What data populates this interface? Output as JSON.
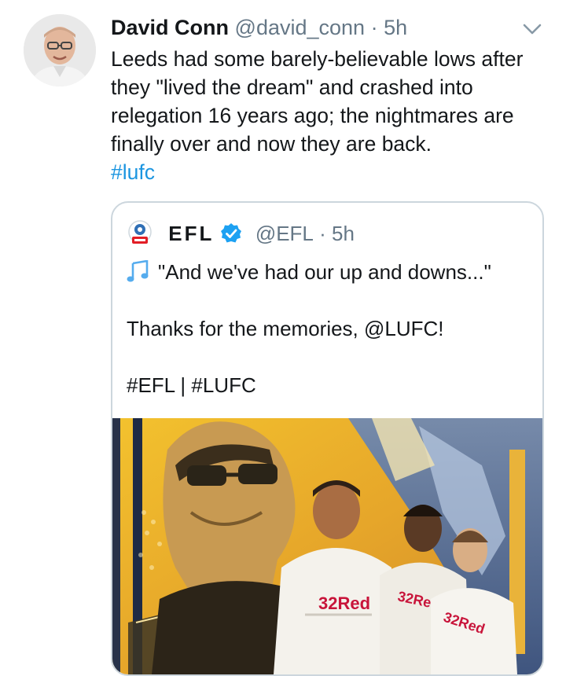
{
  "tweet": {
    "author_name": "David Conn",
    "author_handle": "@david_conn",
    "separator": "·",
    "time": "5h",
    "text": "Leeds had some barely-believable lows after they \"lived the dream\" and crashed into relegation 16 years ago; the nightmares are finally over and now they are back.",
    "hashtag": "#lufc",
    "avatar_icon": "avatar-photo",
    "menu_icon": "chevron-down-icon"
  },
  "quoted_tweet": {
    "author_name": "EFL",
    "verified": true,
    "author_handle": "@EFL",
    "separator": "·",
    "time": "5h",
    "line1": "\"And we've had our up and downs...\"",
    "line2": "Thanks for the memories, @LUFC!",
    "line3": "#EFL | #LUFC",
    "media": {
      "jersey_text_1": "32Red",
      "jersey_text_2": "32Re",
      "jersey_text_3": "32Red"
    }
  },
  "colors": {
    "link": "#1b95e0",
    "muted": "#657786",
    "border": "#ccd6dd",
    "text": "#14171a"
  }
}
